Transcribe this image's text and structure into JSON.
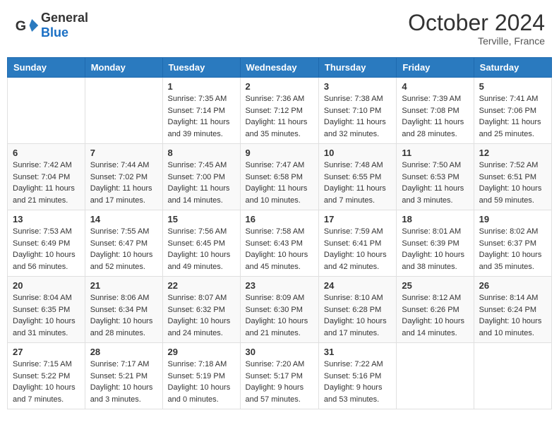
{
  "header": {
    "logo_general": "General",
    "logo_blue": "Blue",
    "title": "October 2024",
    "location": "Terville, France"
  },
  "days_of_week": [
    "Sunday",
    "Monday",
    "Tuesday",
    "Wednesday",
    "Thursday",
    "Friday",
    "Saturday"
  ],
  "weeks": [
    [
      {
        "day": "",
        "info": ""
      },
      {
        "day": "",
        "info": ""
      },
      {
        "day": "1",
        "info": "Sunrise: 7:35 AM\nSunset: 7:14 PM\nDaylight: 11 hours and 39 minutes."
      },
      {
        "day": "2",
        "info": "Sunrise: 7:36 AM\nSunset: 7:12 PM\nDaylight: 11 hours and 35 minutes."
      },
      {
        "day": "3",
        "info": "Sunrise: 7:38 AM\nSunset: 7:10 PM\nDaylight: 11 hours and 32 minutes."
      },
      {
        "day": "4",
        "info": "Sunrise: 7:39 AM\nSunset: 7:08 PM\nDaylight: 11 hours and 28 minutes."
      },
      {
        "day": "5",
        "info": "Sunrise: 7:41 AM\nSunset: 7:06 PM\nDaylight: 11 hours and 25 minutes."
      }
    ],
    [
      {
        "day": "6",
        "info": "Sunrise: 7:42 AM\nSunset: 7:04 PM\nDaylight: 11 hours and 21 minutes."
      },
      {
        "day": "7",
        "info": "Sunrise: 7:44 AM\nSunset: 7:02 PM\nDaylight: 11 hours and 17 minutes."
      },
      {
        "day": "8",
        "info": "Sunrise: 7:45 AM\nSunset: 7:00 PM\nDaylight: 11 hours and 14 minutes."
      },
      {
        "day": "9",
        "info": "Sunrise: 7:47 AM\nSunset: 6:58 PM\nDaylight: 11 hours and 10 minutes."
      },
      {
        "day": "10",
        "info": "Sunrise: 7:48 AM\nSunset: 6:55 PM\nDaylight: 11 hours and 7 minutes."
      },
      {
        "day": "11",
        "info": "Sunrise: 7:50 AM\nSunset: 6:53 PM\nDaylight: 11 hours and 3 minutes."
      },
      {
        "day": "12",
        "info": "Sunrise: 7:52 AM\nSunset: 6:51 PM\nDaylight: 10 hours and 59 minutes."
      }
    ],
    [
      {
        "day": "13",
        "info": "Sunrise: 7:53 AM\nSunset: 6:49 PM\nDaylight: 10 hours and 56 minutes."
      },
      {
        "day": "14",
        "info": "Sunrise: 7:55 AM\nSunset: 6:47 PM\nDaylight: 10 hours and 52 minutes."
      },
      {
        "day": "15",
        "info": "Sunrise: 7:56 AM\nSunset: 6:45 PM\nDaylight: 10 hours and 49 minutes."
      },
      {
        "day": "16",
        "info": "Sunrise: 7:58 AM\nSunset: 6:43 PM\nDaylight: 10 hours and 45 minutes."
      },
      {
        "day": "17",
        "info": "Sunrise: 7:59 AM\nSunset: 6:41 PM\nDaylight: 10 hours and 42 minutes."
      },
      {
        "day": "18",
        "info": "Sunrise: 8:01 AM\nSunset: 6:39 PM\nDaylight: 10 hours and 38 minutes."
      },
      {
        "day": "19",
        "info": "Sunrise: 8:02 AM\nSunset: 6:37 PM\nDaylight: 10 hours and 35 minutes."
      }
    ],
    [
      {
        "day": "20",
        "info": "Sunrise: 8:04 AM\nSunset: 6:35 PM\nDaylight: 10 hours and 31 minutes."
      },
      {
        "day": "21",
        "info": "Sunrise: 8:06 AM\nSunset: 6:34 PM\nDaylight: 10 hours and 28 minutes."
      },
      {
        "day": "22",
        "info": "Sunrise: 8:07 AM\nSunset: 6:32 PM\nDaylight: 10 hours and 24 minutes."
      },
      {
        "day": "23",
        "info": "Sunrise: 8:09 AM\nSunset: 6:30 PM\nDaylight: 10 hours and 21 minutes."
      },
      {
        "day": "24",
        "info": "Sunrise: 8:10 AM\nSunset: 6:28 PM\nDaylight: 10 hours and 17 minutes."
      },
      {
        "day": "25",
        "info": "Sunrise: 8:12 AM\nSunset: 6:26 PM\nDaylight: 10 hours and 14 minutes."
      },
      {
        "day": "26",
        "info": "Sunrise: 8:14 AM\nSunset: 6:24 PM\nDaylight: 10 hours and 10 minutes."
      }
    ],
    [
      {
        "day": "27",
        "info": "Sunrise: 7:15 AM\nSunset: 5:22 PM\nDaylight: 10 hours and 7 minutes."
      },
      {
        "day": "28",
        "info": "Sunrise: 7:17 AM\nSunset: 5:21 PM\nDaylight: 10 hours and 3 minutes."
      },
      {
        "day": "29",
        "info": "Sunrise: 7:18 AM\nSunset: 5:19 PM\nDaylight: 10 hours and 0 minutes."
      },
      {
        "day": "30",
        "info": "Sunrise: 7:20 AM\nSunset: 5:17 PM\nDaylight: 9 hours and 57 minutes."
      },
      {
        "day": "31",
        "info": "Sunrise: 7:22 AM\nSunset: 5:16 PM\nDaylight: 9 hours and 53 minutes."
      },
      {
        "day": "",
        "info": ""
      },
      {
        "day": "",
        "info": ""
      }
    ]
  ]
}
